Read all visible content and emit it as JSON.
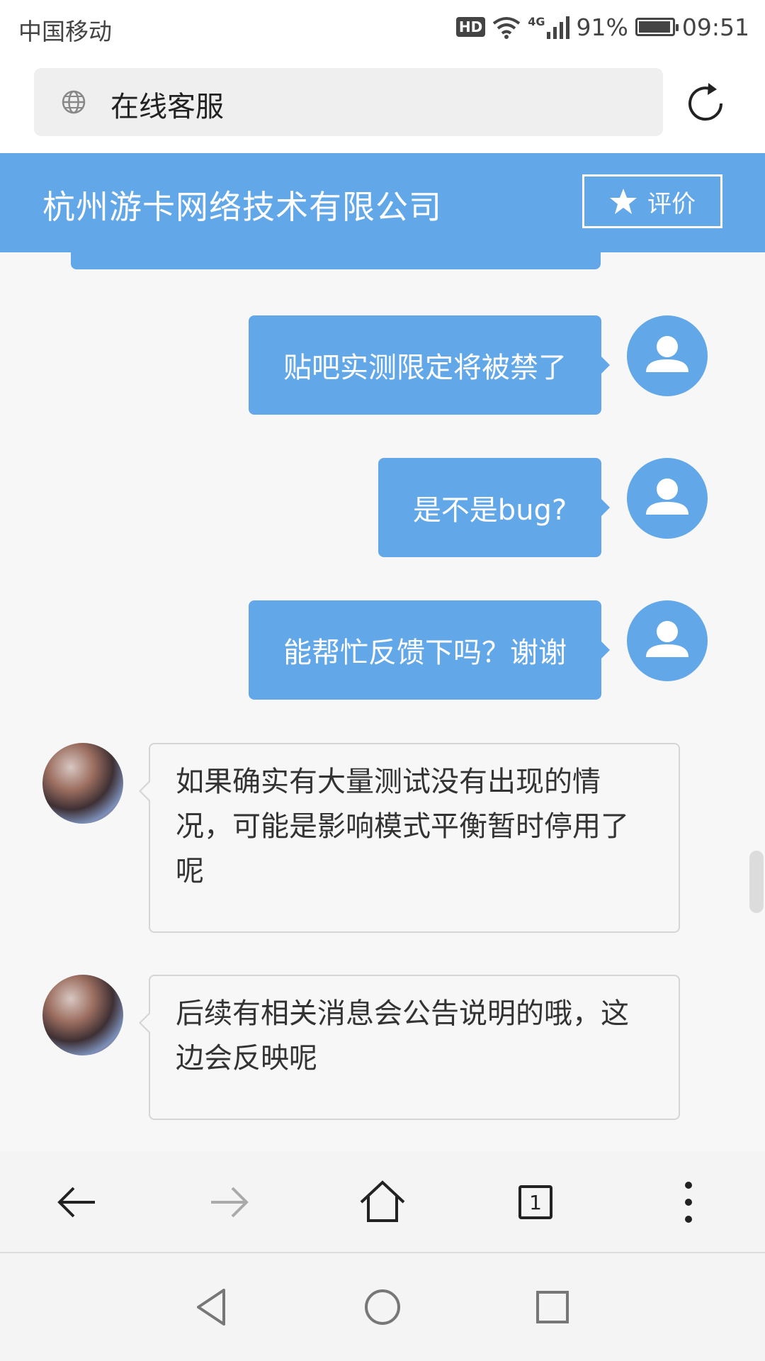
{
  "status_bar": {
    "carrier": "中国移动",
    "hd": "HD",
    "network": "4G",
    "battery": "91%",
    "time": "09:51"
  },
  "address_bar": {
    "page_title": "在线客服",
    "icons": [
      "globe-icon",
      "reload-icon"
    ]
  },
  "header": {
    "company": "杭州游卡网络技术有限公司",
    "rate_label": "评价"
  },
  "messages": [
    {
      "from": "user",
      "text": "贴吧实测限定将被禁了"
    },
    {
      "from": "user",
      "text": "是不是bug?"
    },
    {
      "from": "user",
      "text": "能帮忙反馈下吗？谢谢"
    },
    {
      "from": "agent",
      "text": "如果确实有大量测试没有出现的情况，可能是影响模式平衡暂时停用了呢"
    },
    {
      "from": "agent",
      "text": "后续有相关消息会公告说明的哦，这边会反映呢"
    }
  ],
  "toolbar": {
    "tab_count": "1",
    "icons": [
      "back-arrow-icon",
      "forward-arrow-icon",
      "home-icon",
      "tabs-icon",
      "more-icon"
    ]
  },
  "nav_bar": {
    "icons": [
      "nav-back-icon",
      "nav-home-icon",
      "nav-recents-icon"
    ]
  },
  "colors": {
    "accent": "#62a8e8",
    "background": "#f7f7f7"
  }
}
